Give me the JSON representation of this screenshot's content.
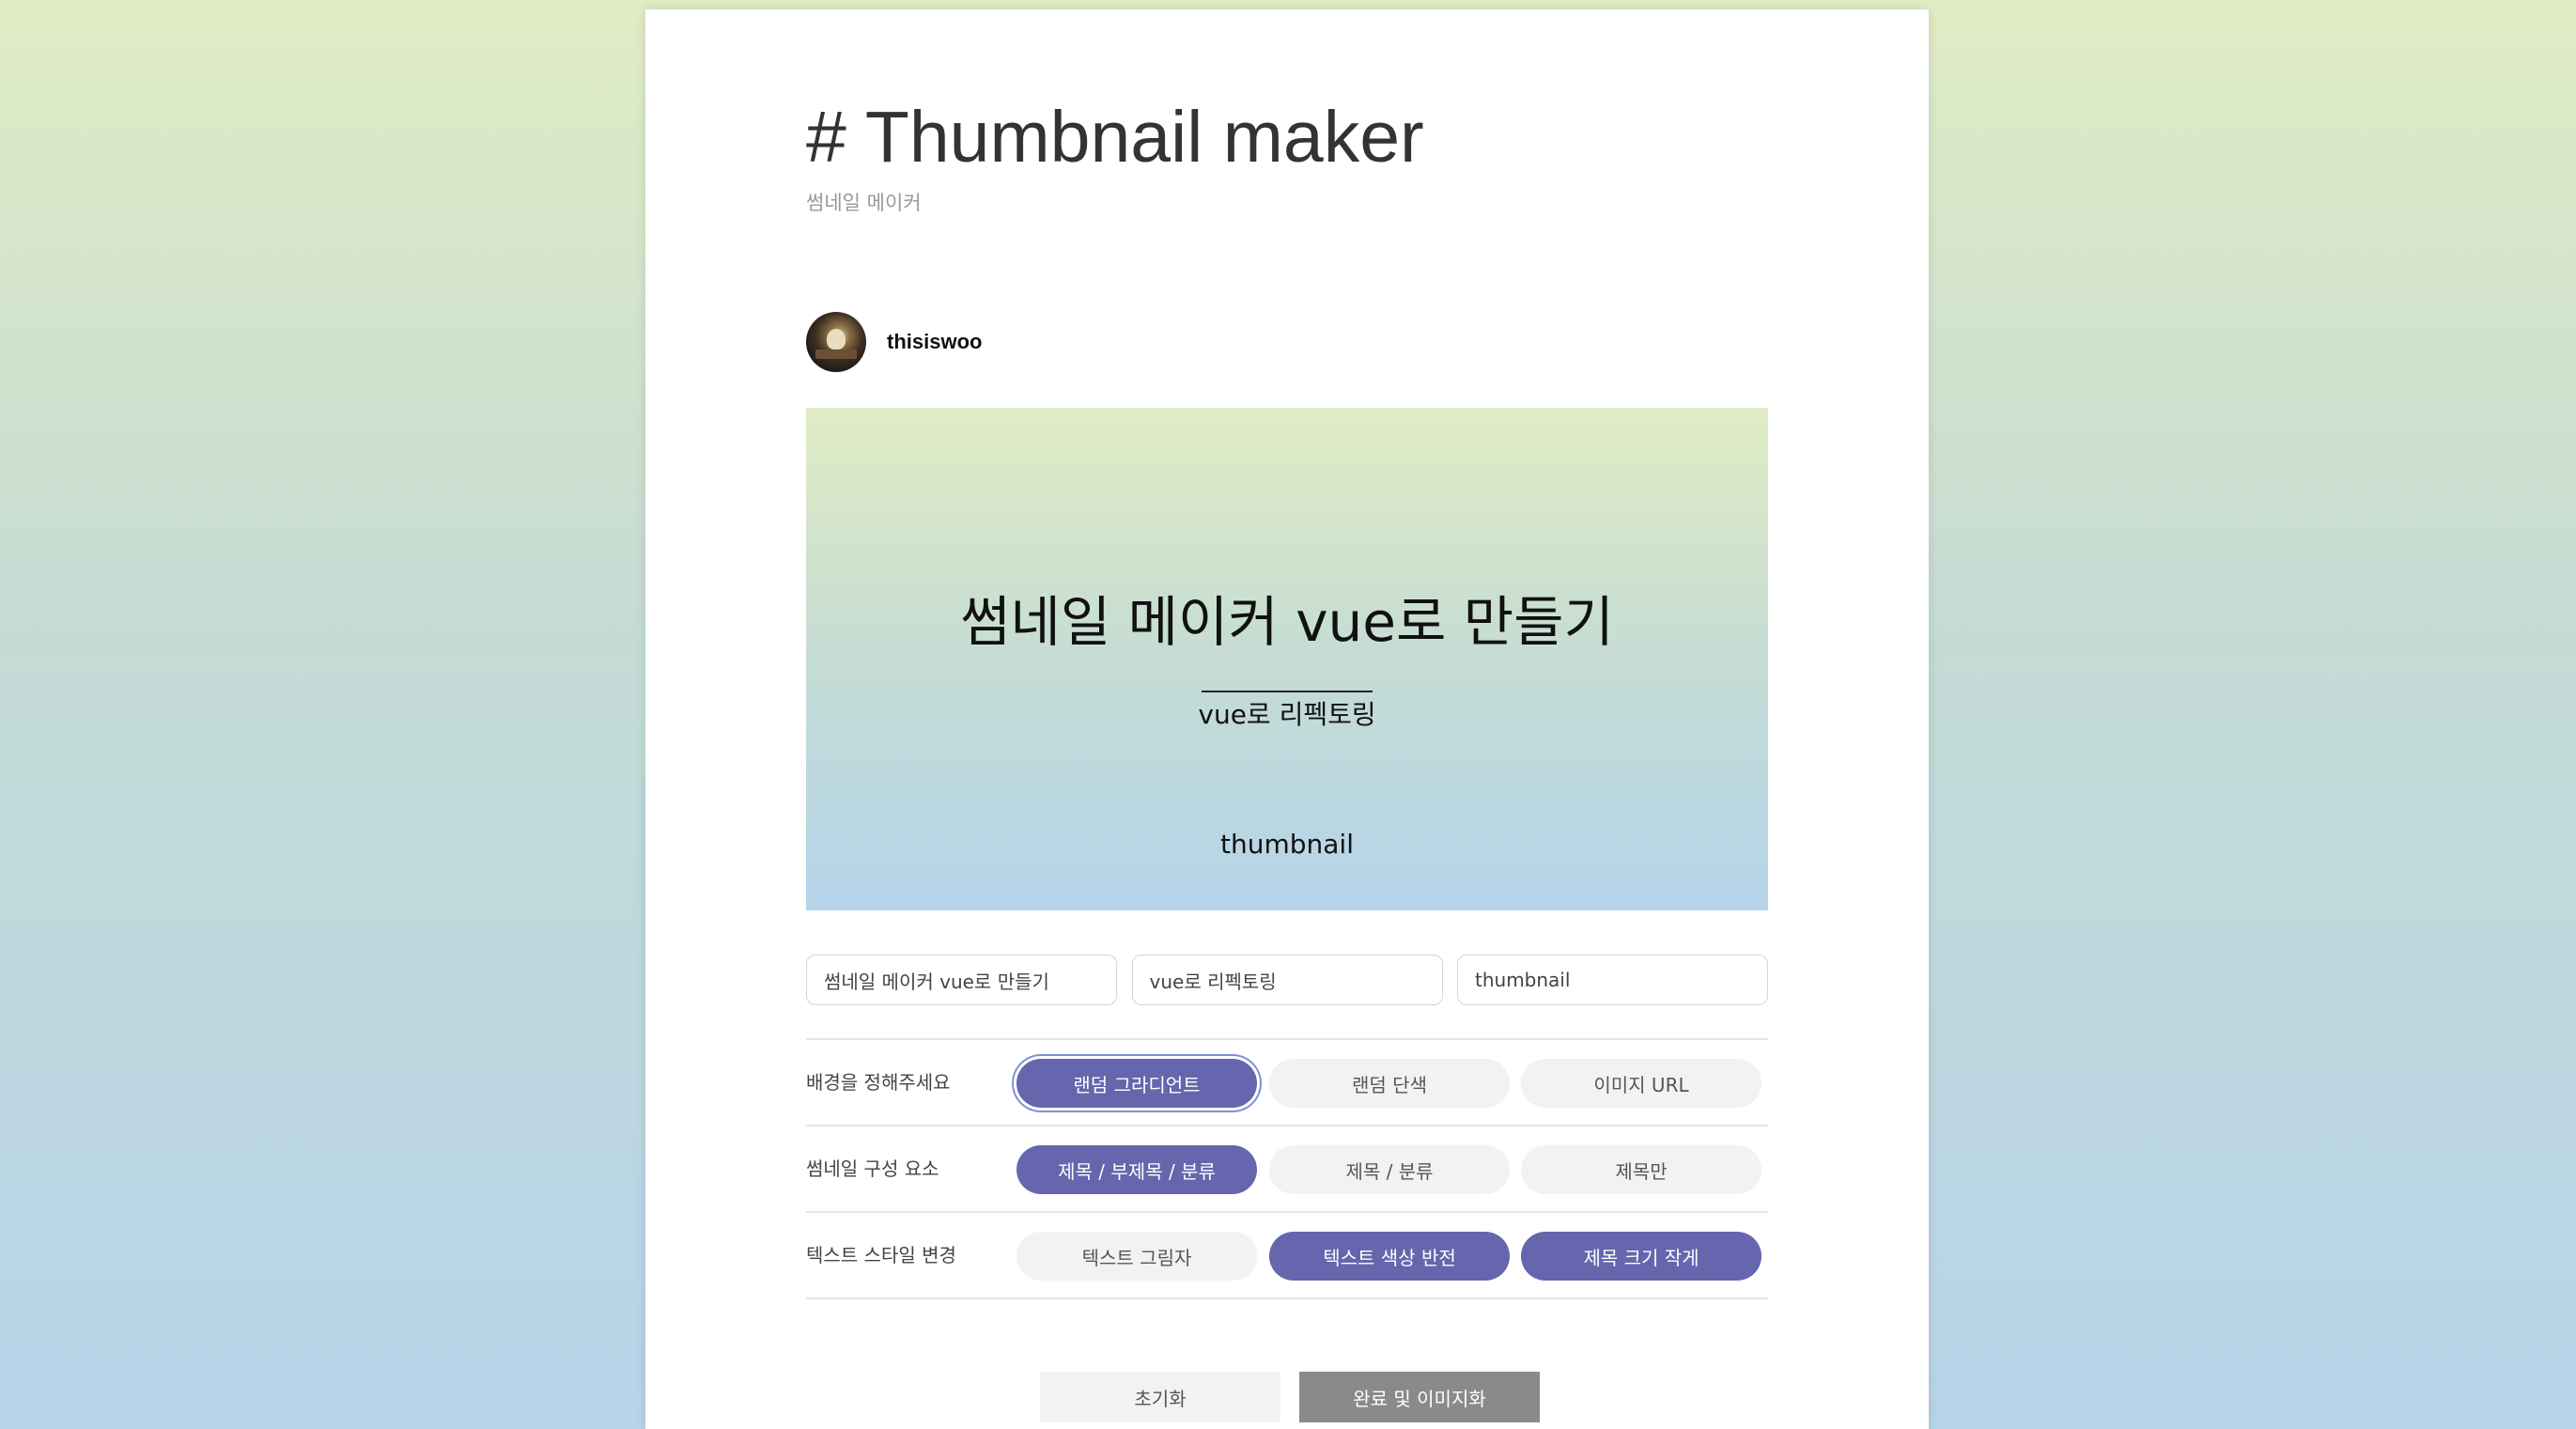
{
  "page": {
    "title": "# Thumbnail maker",
    "subtitle": "썸네일 메이커"
  },
  "author": {
    "name": "thisiswoo",
    "avatar_icon": "avatar-photo"
  },
  "preview": {
    "title": "썸네일 메이커 vue로 만들기",
    "subtitle": "vue로 리펙토링",
    "category": "thumbnail",
    "gradient_top": "#e1ecc4",
    "gradient_bottom": "#b5d4ea"
  },
  "inputs": {
    "title_value": "썸네일 메이커 vue로 만들기",
    "subtitle_value": "vue로 리펙토링",
    "category_value": "thumbnail"
  },
  "options": {
    "background": {
      "label": "배경을 정해주세요",
      "buttons": [
        "랜덤 그라디언트",
        "랜덤 단색",
        "이미지 URL"
      ],
      "selected": "랜덤 그라디언트"
    },
    "composition": {
      "label": "썸네일 구성 요소",
      "buttons": [
        "제목 / 부제목 / 분류",
        "제목 / 분류",
        "제목만"
      ],
      "selected": "제목 / 부제목 / 분류"
    },
    "text_style": {
      "label": "텍스트 스타일 변경",
      "buttons": [
        "텍스트 그림자",
        "텍스트 색상 반전",
        "제목 크기 작게"
      ],
      "active": [
        "텍스트 색상 반전",
        "제목 크기 작게"
      ]
    }
  },
  "actions": {
    "reset_label": "초기화",
    "done_label": "완료 및 이미지화"
  },
  "colors": {
    "accent": "#6566ad",
    "button_idle": "#f2f2f2",
    "done_button": "#8a8a8a"
  }
}
